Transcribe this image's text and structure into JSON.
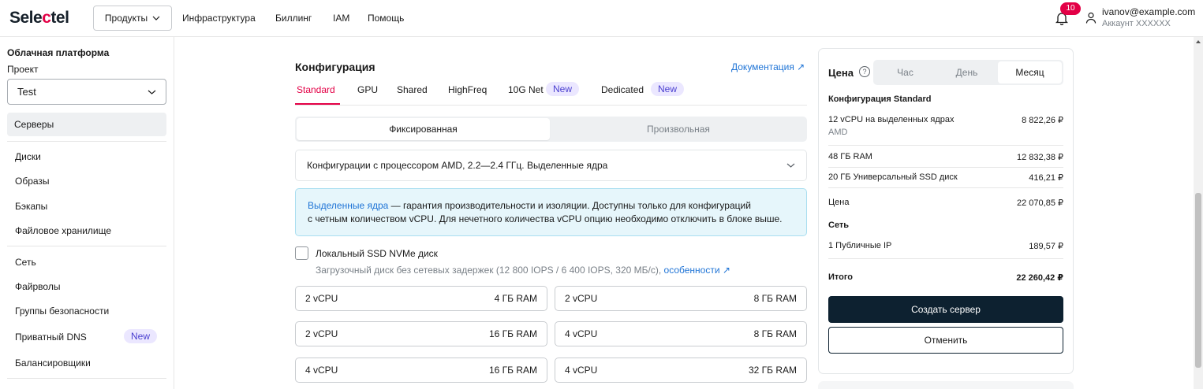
{
  "header": {
    "logo": "Selectel",
    "products_label": "Продукты",
    "nav": [
      "Инфраструктура",
      "Биллинг",
      "IAM",
      "Помощь"
    ],
    "notifications_count": "10",
    "user_email": "ivanov@example.com",
    "user_account": "Аккаунт XXXXXX"
  },
  "sidebar": {
    "heading": "Облачная платформа",
    "project_label": "Проект",
    "project_value": "Test",
    "active_item": "Серверы",
    "items": [
      "Диски",
      "Образы",
      "Бэкапы",
      "Файловое хранилище"
    ],
    "items2": [
      "Сеть",
      "Файрволы",
      "Группы безопасности",
      "Приватный DNS",
      "Балансировщики"
    ],
    "new_badge": "New"
  },
  "main": {
    "title": "Конфигурация",
    "doc_link": "Документация ↗",
    "tabs": [
      "Standard",
      "GPU",
      "Shared",
      "HighFreq",
      "10G Net",
      "Dedicated"
    ],
    "tab_new": "New",
    "mode_fixed": "Фиксированная",
    "mode_custom": "Произвольная",
    "cpu_select": "Конфигурации с процессором AMD, 2.2—2.4 ГГц. Выделенные ядра",
    "info_link": "Выделенные ядра",
    "info_text1": " — гарантия производительности и изоляции. Доступны только для конфигураций",
    "info_text2": "с четным количеством vCPU. Для нечетного количества vCPU опцию необходимо отключить в блоке выше.",
    "local_disk_label": "Локальный SSD NVMe диск",
    "local_disk_desc": "Загрузочный диск без сетевых задержек (12 800 IOPS / 6 400 IOPS, 320 МБ/с), ",
    "local_disk_link": "особенности ↗",
    "configs": [
      {
        "cpu": "2 vCPU",
        "ram": "4 ГБ RAM"
      },
      {
        "cpu": "2 vCPU",
        "ram": "8 ГБ RAM"
      },
      {
        "cpu": "2 vCPU",
        "ram": "16 ГБ RAM"
      },
      {
        "cpu": "4 vCPU",
        "ram": "8 ГБ RAM"
      },
      {
        "cpu": "4 vCPU",
        "ram": "16 ГБ RAM"
      },
      {
        "cpu": "4 vCPU",
        "ram": "32 ГБ RAM"
      }
    ]
  },
  "price": {
    "title": "Цена",
    "periods": [
      "Час",
      "День",
      "Месяц"
    ],
    "config_heading": "Конфигурация Standard",
    "cpu_label_1": "12 vCPU на выделенных ядрах",
    "cpu_label_2": "AMD",
    "cpu_value": "8 822,26 ₽",
    "ram_label": "48 ГБ RAM",
    "ram_value": "12 832,38 ₽",
    "disk_label": "20 ГБ Универсальный SSD диск",
    "disk_value": "416,21 ₽",
    "subtotal_label": "Цена",
    "subtotal_value": "22 070,85 ₽",
    "network_heading": "Сеть",
    "ip_label": "1 Публичные IP",
    "ip_value": "189,57 ₽",
    "total_label": "Итого",
    "total_value": "22 260,42 ₽",
    "create_button": "Создать сервер",
    "cancel_button": "Отменить"
  }
}
